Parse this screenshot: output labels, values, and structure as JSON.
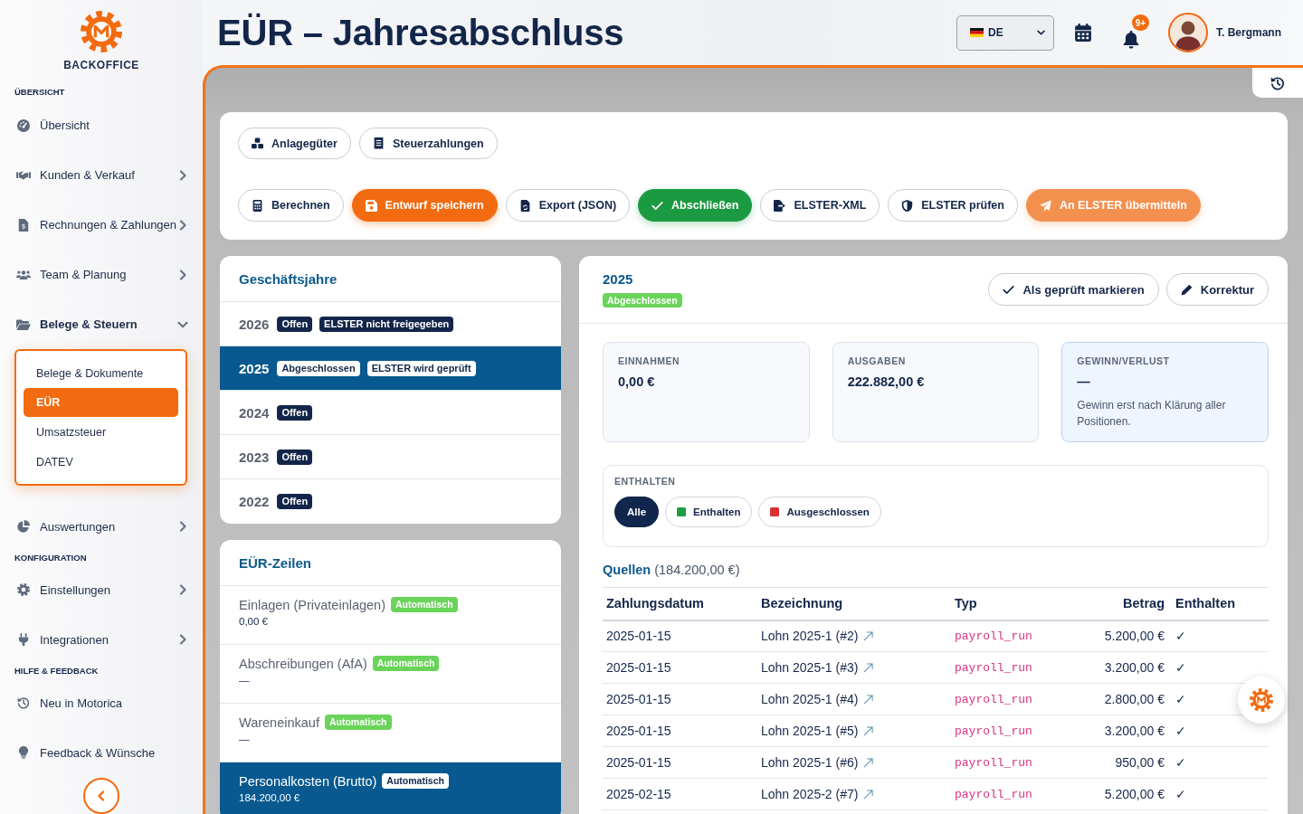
{
  "sidebar": {
    "brand": "BACKOFFICE",
    "sections": [
      {
        "title": "ÜBERSICHT",
        "items": [
          {
            "label": "Übersicht"
          },
          {
            "label": "Kunden & Verkauf",
            "expanded": false
          },
          {
            "label": "Rechnungen & Zahlungen",
            "expanded": false
          },
          {
            "label": "Team & Planung",
            "expanded": false
          },
          {
            "label": "Belege & Steuern",
            "expanded": true,
            "children": [
              {
                "label": "Belege & Dokumente",
                "selected": false
              },
              {
                "label": "EÜR",
                "selected": true
              },
              {
                "label": "Umsatzsteuer",
                "selected": false
              },
              {
                "label": "DATEV",
                "selected": false
              }
            ]
          },
          {
            "label": "Auswertungen",
            "expanded": false
          }
        ]
      },
      {
        "title": "KONFIGURATION",
        "items": [
          {
            "label": "Einstellungen",
            "expanded": false
          },
          {
            "label": "Integrationen",
            "expanded": false
          }
        ]
      },
      {
        "title": "HILFE & FEEDBACK",
        "items": [
          {
            "label": "Neu in Motorica"
          },
          {
            "label": "Feedback & Wünsche"
          }
        ]
      }
    ]
  },
  "header": {
    "title": "EÜR – Jahresabschluss",
    "language": {
      "value": "DE"
    },
    "notifications": {
      "badge": "9+"
    },
    "user": {
      "name": "T. Bergmann"
    }
  },
  "toolbar": {
    "rows": [
      [
        {
          "label": "Anlagegüter",
          "kind": "outline"
        },
        {
          "label": "Steuerzahlungen",
          "kind": "outline"
        }
      ],
      [
        {
          "label": "Berechnen",
          "kind": "outline"
        },
        {
          "label": "Entwurf speichern",
          "kind": "primary"
        },
        {
          "label": "Export (JSON)",
          "kind": "outline"
        },
        {
          "label": "Abschließen",
          "kind": "success"
        },
        {
          "label": "ELSTER-XML",
          "kind": "outline"
        },
        {
          "label": "ELSTER prüfen",
          "kind": "outline"
        },
        {
          "label": "An ELSTER übermitteln",
          "kind": "accent"
        }
      ]
    ]
  },
  "fiscal_years": {
    "title": "Geschäftsjahre",
    "items": [
      {
        "year": "2026",
        "selected": false,
        "badges": [
          "Offen",
          "ELSTER nicht freigegeben"
        ]
      },
      {
        "year": "2025",
        "selected": true,
        "badges": [
          "Abgeschlossen",
          "ELSTER wird geprüft"
        ]
      },
      {
        "year": "2024",
        "selected": false,
        "badges": [
          "Offen"
        ]
      },
      {
        "year": "2023",
        "selected": false,
        "badges": [
          "Offen"
        ]
      },
      {
        "year": "2022",
        "selected": false,
        "badges": [
          "Offen"
        ]
      }
    ]
  },
  "euer_lines": {
    "title": "EÜR-Zeilen",
    "items": [
      {
        "label": "Einlagen (Privateinlagen)",
        "badge": "Automatisch",
        "amount": "0,00 €",
        "selected": false
      },
      {
        "label": "Abschreibungen (AfA)",
        "badge": "Automatisch",
        "amount": "—",
        "selected": false
      },
      {
        "label": "Wareneinkauf",
        "badge": "Automatisch",
        "amount": "—",
        "selected": false
      },
      {
        "label": "Personalkosten (Brutto)",
        "badge": "Automatisch",
        "amount": "184.200,00 €",
        "selected": true
      }
    ]
  },
  "detail": {
    "title": "2025",
    "status": "Abgeschlossen",
    "actions": [
      {
        "label": "Als geprüft markieren"
      },
      {
        "label": "Korrektur"
      }
    ],
    "stats": [
      {
        "label": "EINNAHMEN",
        "value": "0,00 €",
        "highlighted": false
      },
      {
        "label": "AUSGABEN",
        "value": "222.882,00 €",
        "highlighted": false
      },
      {
        "label": "GEWINN/VERLUST",
        "value": "—",
        "note": "Gewinn erst nach Klärung aller Positionen.",
        "highlighted": true
      }
    ],
    "filter": {
      "label": "ENTHALTEN",
      "options": [
        {
          "label": "Alle",
          "selected": true
        },
        {
          "label": "Enthalten",
          "selected": false,
          "color": "#1f9d46"
        },
        {
          "label": "Ausgeschlossen",
          "selected": false,
          "color": "#dc2f2f"
        }
      ]
    },
    "sources": {
      "title": "Quellen",
      "total": "(184.200,00 €)",
      "columns": [
        "Zahlungsdatum",
        "Bezeichnung",
        "Typ",
        "Betrag",
        "Enthalten"
      ],
      "rows": [
        {
          "date": "2025-01-15",
          "name": "Lohn 2025-1 (#2)",
          "type": "payroll_run",
          "amount": "5.200,00 €",
          "included": "✓"
        },
        {
          "date": "2025-01-15",
          "name": "Lohn 2025-1 (#3)",
          "type": "payroll_run",
          "amount": "3.200,00 €",
          "included": "✓"
        },
        {
          "date": "2025-01-15",
          "name": "Lohn 2025-1 (#4)",
          "type": "payroll_run",
          "amount": "2.800,00 €",
          "included": "✓"
        },
        {
          "date": "2025-01-15",
          "name": "Lohn 2025-1 (#5)",
          "type": "payroll_run",
          "amount": "3.200,00 €",
          "included": "✓"
        },
        {
          "date": "2025-01-15",
          "name": "Lohn 2025-1 (#6)",
          "type": "payroll_run",
          "amount": "950,00 €",
          "included": "✓"
        },
        {
          "date": "2025-02-15",
          "name": "Lohn 2025-2 (#7)",
          "type": "payroll_run",
          "amount": "5.200,00 €",
          "included": "✓"
        }
      ]
    }
  }
}
